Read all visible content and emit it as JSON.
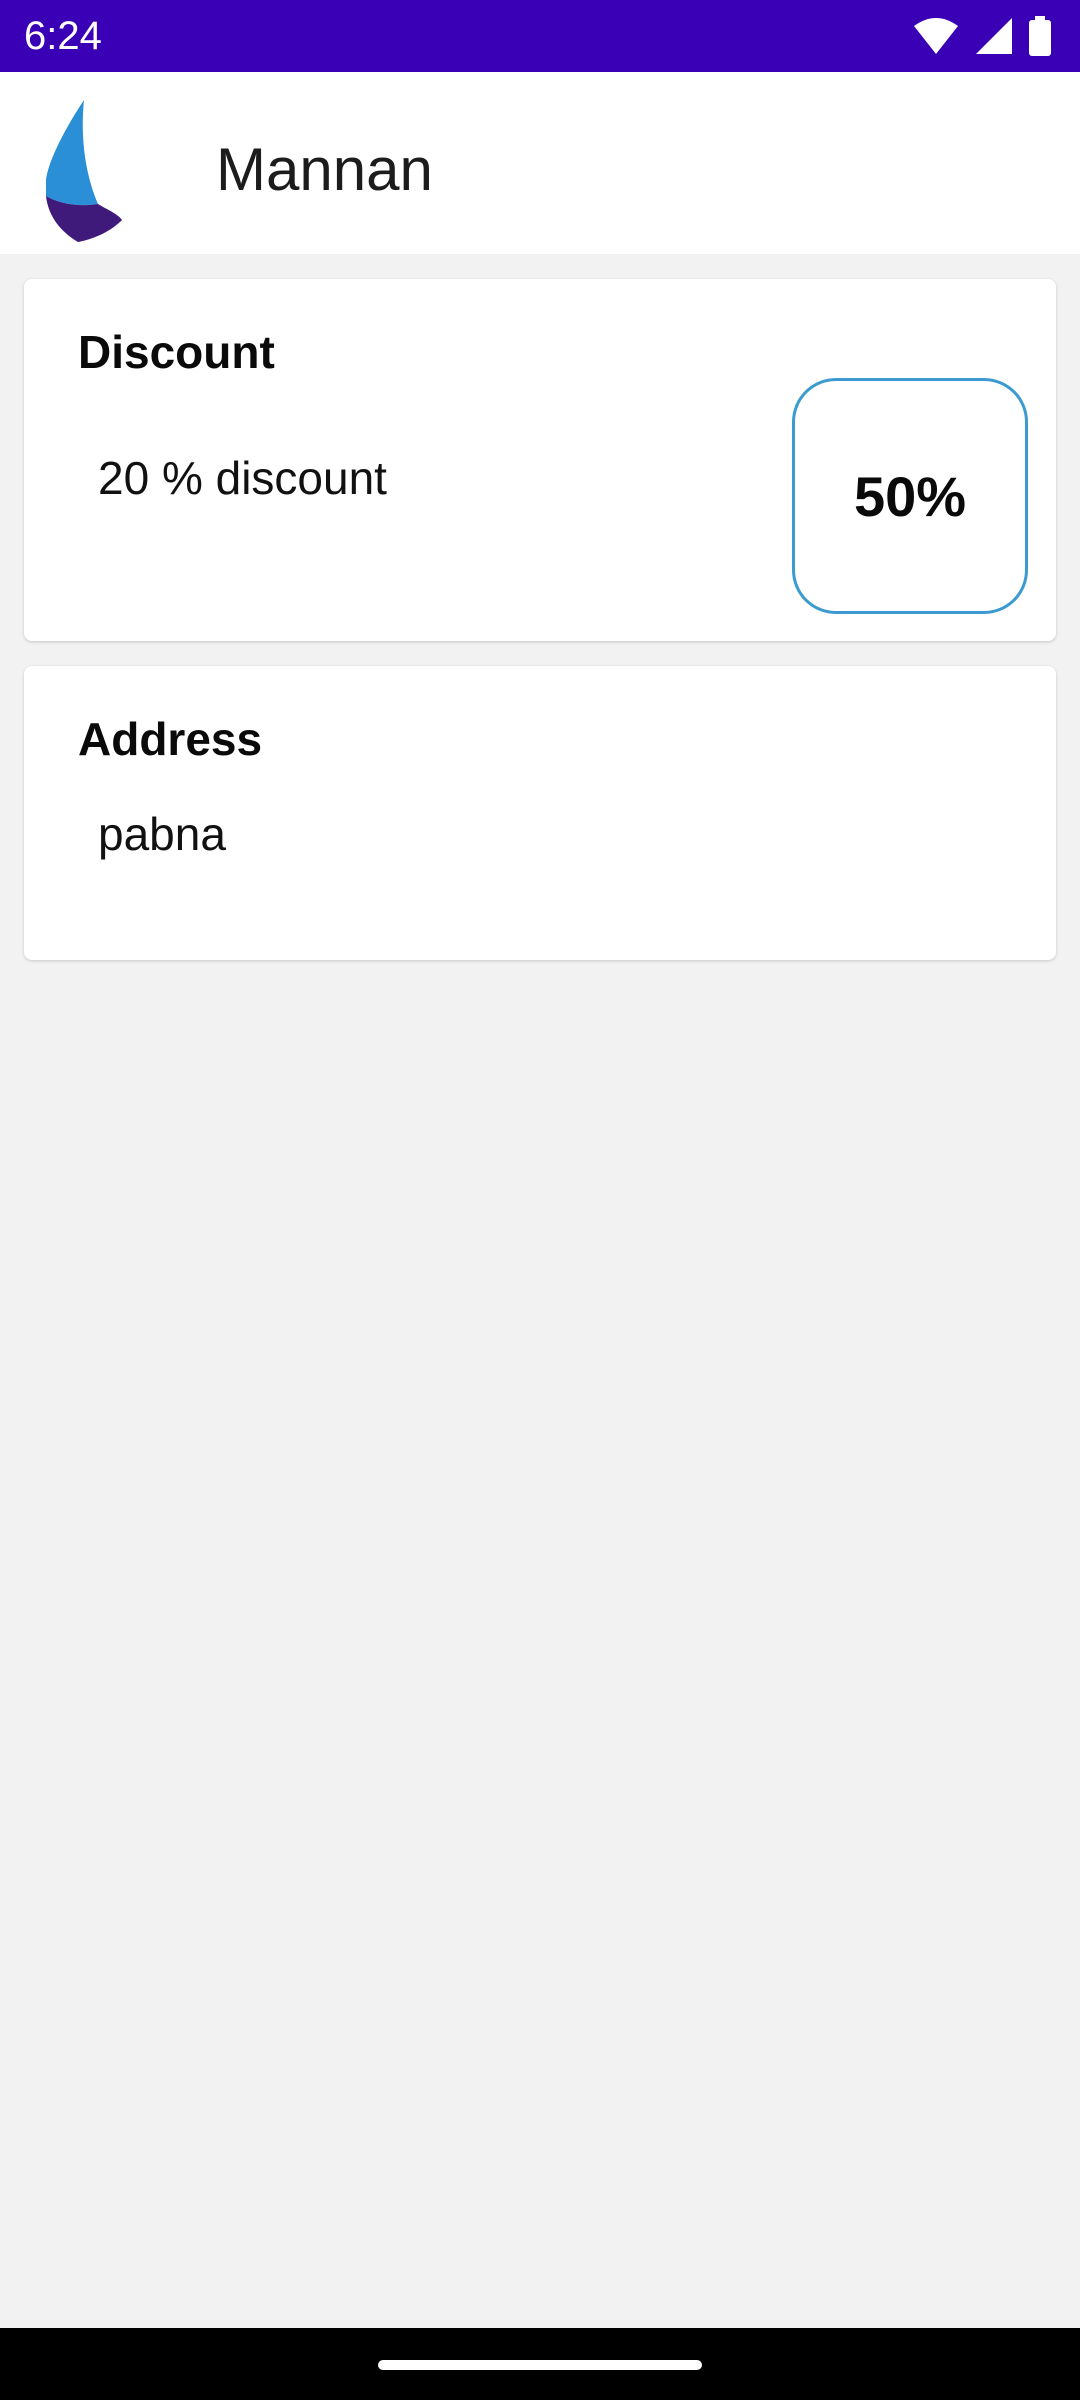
{
  "status_bar": {
    "time": "6:24",
    "icons": [
      "wifi-icon",
      "signal-icon",
      "battery-icon"
    ]
  },
  "app_bar": {
    "title": "Mannan",
    "logo_icon": "sailboat-logo-icon"
  },
  "discount_card": {
    "heading": "Discount",
    "description": "20 % discount",
    "percent": "50%"
  },
  "address_card": {
    "heading": "Address",
    "value": "pabna"
  },
  "colors": {
    "status_bar": "#3a00b5",
    "background": "#f2f2f2",
    "accent_border": "#3b9ad0",
    "logo_blue": "#2a8fd6",
    "logo_purple": "#3f1a7a"
  }
}
